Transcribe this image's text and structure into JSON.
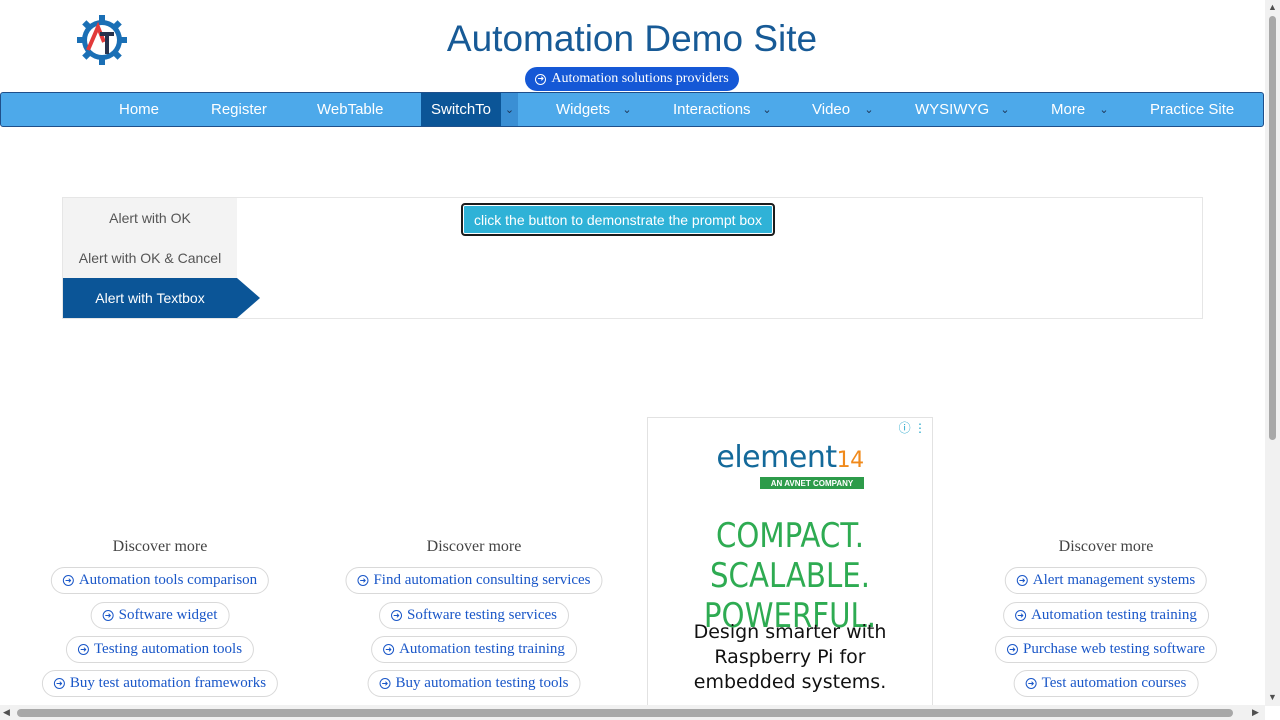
{
  "header": {
    "title": "Automation Demo Site",
    "logo_icon": "automation-testing-logo-icon",
    "promo": "Automation solutions providers"
  },
  "nav": {
    "items": [
      {
        "label": "Home"
      },
      {
        "label": "Register"
      },
      {
        "label": "WebTable"
      },
      {
        "label": "SwitchTo",
        "active": true
      },
      {
        "label": "Widgets"
      },
      {
        "label": "Interactions"
      },
      {
        "label": "Video"
      },
      {
        "label": "WYSIWYG"
      },
      {
        "label": "More"
      },
      {
        "label": "Practice Site"
      }
    ],
    "bg_color": "#4da9ea",
    "active_color": "#0b5597"
  },
  "alerts": {
    "tabs": [
      {
        "label": "Alert with OK"
      },
      {
        "label": "Alert with OK & Cancel"
      },
      {
        "label": "Alert with Textbox",
        "active": true
      }
    ],
    "button_label": "click the button to demonstrate the prompt box"
  },
  "discover": [
    {
      "title": "Discover more",
      "links": [
        "Automation tools comparison",
        "Software widget",
        "Testing automation tools",
        "Buy test automation frameworks"
      ]
    },
    {
      "title": "Discover more",
      "links": [
        "Find automation consulting services",
        "Software testing services",
        "Automation testing training",
        "Buy automation testing tools"
      ]
    },
    {
      "title": "Discover more",
      "links": [
        "Alert management systems",
        "Automation testing training",
        "Purchase web testing software",
        "Test automation courses"
      ]
    }
  ],
  "ad": {
    "brand": "element",
    "brand_number": "14",
    "brand_sub": "AN AVNET COMPANY",
    "headline_1": "COMPACT. SCALABLE.",
    "headline_2": "POWERFUL.",
    "body_1": "Design smarter with",
    "body_2": "Raspberry Pi for",
    "body_3": "embedded systems."
  }
}
